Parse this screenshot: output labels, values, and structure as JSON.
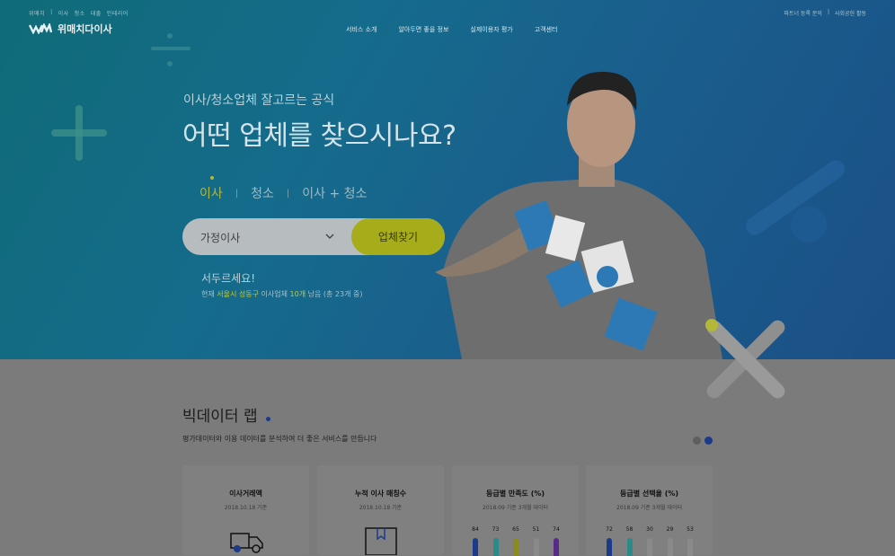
{
  "util_links": [
    "위매치",
    "이사",
    "청소",
    "대출",
    "인테리어"
  ],
  "util_right": [
    "파트너 등록 문의",
    "사회공헌 활동"
  ],
  "brand": {
    "name": "위매치다이사"
  },
  "nav": [
    "서비스 소개",
    "알아두면 좋을 정보",
    "실제이용자 평가",
    "고객센터"
  ],
  "hero": {
    "subtitle": "이사/청소업체 잘고르는 공식",
    "title": "어떤 업체를 찾으시나요?",
    "tabs": [
      "이사",
      "청소",
      "이사 + 청소"
    ],
    "select_value": "가정이사",
    "find_button": "업체찾기",
    "hurry": "서두르세요!",
    "status_prefix": "현재",
    "status_location": "서울시 성동구",
    "status_mid": "이사업체",
    "status_count": "10개",
    "status_suffix": "남음 (총 23개 중)"
  },
  "bigdata": {
    "title": "빅데이터 랩",
    "subtitle": "평가데이터와 이용 데이터를 분석하여 더 좋은 서비스를 만듭니다",
    "cards": [
      {
        "title": "이사거래액",
        "date": "2018.10.18 기준",
        "icon": "truck-icon"
      },
      {
        "title": "누적 이사 매칭수",
        "date": "2018.10.18 기준",
        "icon": "box-icon"
      },
      {
        "title": "등급별 만족도 (%)",
        "date": "2018.09 기준 3개월 데이터",
        "values": [
          "84",
          "73",
          "65",
          "51",
          "74"
        ]
      },
      {
        "title": "등급별 선택율 (%)",
        "date": "2018.09 기준 3개월 데이터",
        "values": [
          "72",
          "58",
          "30",
          "29",
          "53"
        ]
      }
    ]
  },
  "colors": {
    "accent": "#b3b838",
    "blue": "#1b4f86"
  }
}
